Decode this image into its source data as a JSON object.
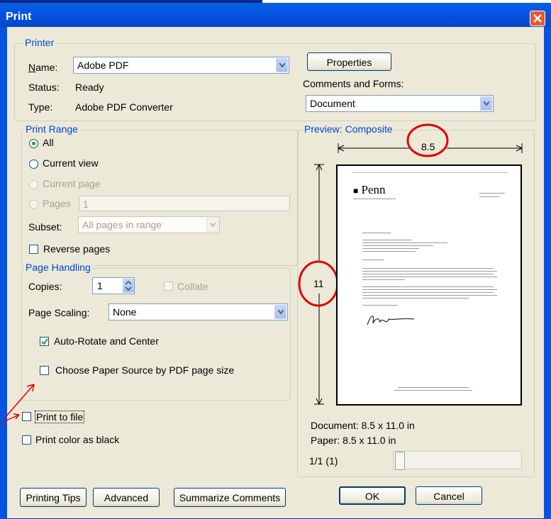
{
  "dialog": {
    "title": "Print"
  },
  "printer": {
    "legend": "Printer",
    "name_label": "Name:",
    "name_value": "Adobe PDF",
    "status_label": "Status:",
    "status_value": "Ready",
    "type_label": "Type:",
    "type_value": "Adobe PDF Converter",
    "properties_label": "Properties",
    "comments_label": "Comments and Forms:",
    "comments_value": "Document"
  },
  "print_range": {
    "legend": "Print Range",
    "all_label": "All",
    "current_view_label": "Current view",
    "current_page_label": "Current page",
    "pages_label": "Pages",
    "pages_value": "1",
    "subset_label": "Subset:",
    "subset_value": "All pages in range",
    "reverse_label": "Reverse pages",
    "selected": "All"
  },
  "page_handling": {
    "legend": "Page Handling",
    "copies_label": "Copies:",
    "copies_value": "1",
    "collate_label": "Collate",
    "scaling_label": "Page Scaling:",
    "scaling_value": "None",
    "auto_rotate_label": "Auto-Rotate and Center",
    "auto_rotate_checked": true,
    "paper_source_label": "Choose Paper Source by PDF page size",
    "paper_source_checked": false
  },
  "options": {
    "print_to_file_label": "Print to file",
    "print_color_black_label": "Print color as black"
  },
  "preview": {
    "legend": "Preview: Composite",
    "width_label": "8.5",
    "height_label": "11",
    "document_size": "Document: 8.5 x 11.0 in",
    "paper_size": "Paper: 8.5 x 11.0 in",
    "page_count": "1/1 (1)",
    "page_position_fraction": 0,
    "letterhead": "Penn"
  },
  "buttons": {
    "printing_tips": "Printing Tips",
    "advanced": "Advanced",
    "summarize_comments": "Summarize Comments",
    "ok": "OK",
    "cancel": "Cancel"
  },
  "colors": {
    "title_bar": "#0454e1",
    "group_legend": "#0046d5",
    "dialog_face": "#ece9d8",
    "annotation_red": "#e00000",
    "close_button": "#e55934"
  }
}
